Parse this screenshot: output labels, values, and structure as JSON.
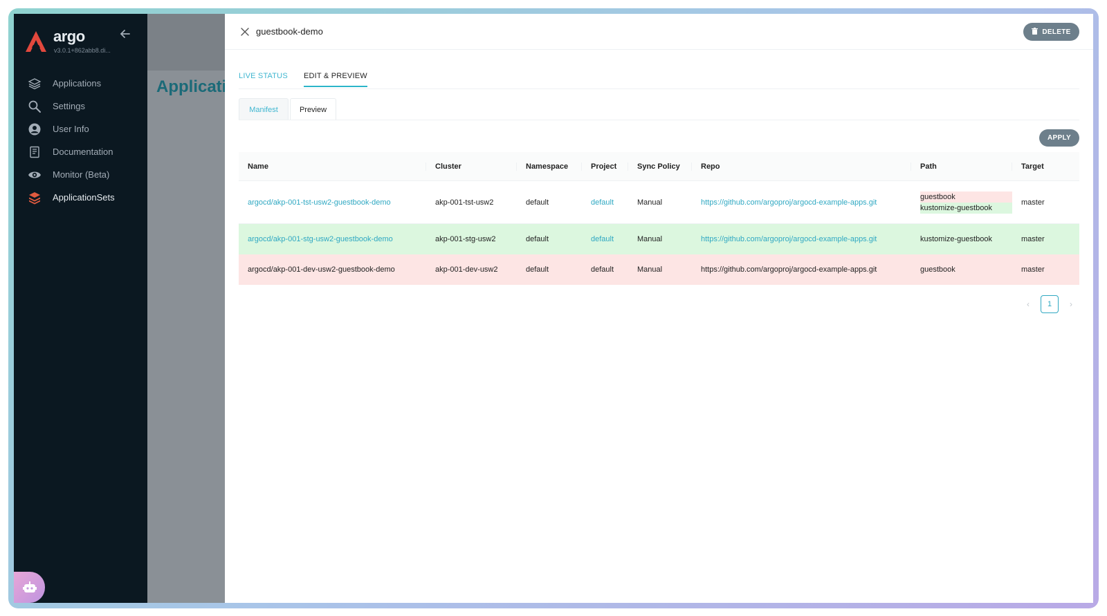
{
  "sidebar": {
    "brand": "argo",
    "version": "v3.0.1+862abb8.di...",
    "items": [
      {
        "label": "Applications",
        "icon": "layers-icon"
      },
      {
        "label": "Settings",
        "icon": "search-icon"
      },
      {
        "label": "User Info",
        "icon": "user-icon"
      },
      {
        "label": "Documentation",
        "icon": "book-icon"
      },
      {
        "label": "Monitor (Beta)",
        "icon": "eye-icon"
      },
      {
        "label": "ApplicationSets",
        "icon": "stack-icon"
      }
    ]
  },
  "background": {
    "title": "Applications"
  },
  "panel": {
    "title": "guestbook-demo",
    "delete_label": "DELETE",
    "tabs": [
      {
        "label": "LIVE STATUS"
      },
      {
        "label": "EDIT & PREVIEW"
      }
    ],
    "subtabs": [
      {
        "label": "Manifest"
      },
      {
        "label": "Preview"
      }
    ],
    "apply_label": "APPLY"
  },
  "table": {
    "columns": [
      "Name",
      "Cluster",
      "Namespace",
      "Project",
      "Sync Policy",
      "Repo",
      "Path",
      "Target"
    ],
    "rows": [
      {
        "name": "argocd/akp-001-tst-usw2-guestbook-demo",
        "cluster": "akp-001-tst-usw2",
        "namespace": "default",
        "project": "default",
        "sync_policy": "Manual",
        "repo": "https://github.com/argoproj/argocd-example-apps.git",
        "path_old": "guestbook",
        "path_new": "kustomize-guestbook",
        "target": "master",
        "status": "modified"
      },
      {
        "name": "argocd/akp-001-stg-usw2-guestbook-demo",
        "cluster": "akp-001-stg-usw2",
        "namespace": "default",
        "project": "default",
        "sync_policy": "Manual",
        "repo": "https://github.com/argoproj/argocd-example-apps.git",
        "path": "kustomize-guestbook",
        "target": "master",
        "status": "added"
      },
      {
        "name": "argocd/akp-001-dev-usw2-guestbook-demo",
        "cluster": "akp-001-dev-usw2",
        "namespace": "default",
        "project": "default",
        "sync_policy": "Manual",
        "repo": "https://github.com/argoproj/argocd-example-apps.git",
        "path": "guestbook",
        "target": "master",
        "status": "removed"
      }
    ]
  },
  "pagination": {
    "current": "1"
  },
  "colors": {
    "accent": "#2fa8c2",
    "added": "#dcf7df",
    "removed": "#fde5e4",
    "sidebar": "#0b1821"
  }
}
